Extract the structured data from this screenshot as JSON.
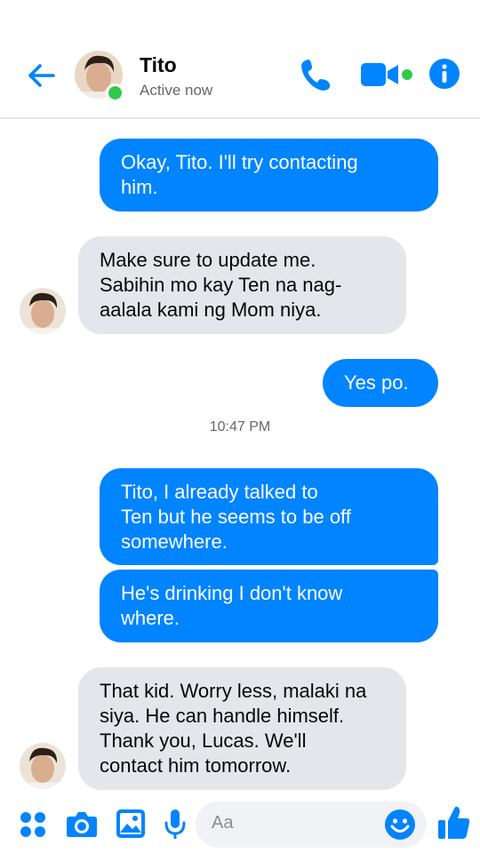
{
  "header": {
    "contact_name": "Tito",
    "status": "Active now"
  },
  "messages": [
    {
      "direction": "outgoing",
      "text": "Okay, Tito. I'll try contacting\nhim."
    },
    {
      "direction": "incoming",
      "text": "Make sure to update me.\nSabihin mo kay Ten na nag-\naalala kami ng Mom niya."
    },
    {
      "direction": "outgoing",
      "text": "Yes po."
    },
    {
      "direction": "outgoing",
      "text": "Tito, I already talked to\nTen but he seems to be off\nsomewhere."
    },
    {
      "direction": "outgoing",
      "text": "He's drinking I don't know\nwhere."
    },
    {
      "direction": "incoming",
      "text": "That kid. Worry less, malaki na\nsiya. He can handle himself.\nThank you, Lucas. We'll\ncontact him tomorrow."
    }
  ],
  "timestamp": "10:47 PM",
  "composer": {
    "placeholder": "Aa"
  },
  "icons": {
    "back": "back-arrow-icon",
    "call": "phone-icon",
    "video": "video-camera-icon",
    "info": "info-icon",
    "apps": "four-dots-icon",
    "camera": "camera-icon",
    "gallery": "image-icon",
    "voice": "microphone-icon",
    "emoji": "smiley-icon",
    "like": "thumbs-up-icon"
  },
  "colors": {
    "accent": "#0084ff",
    "online": "#31c94a",
    "incoming_bubble": "#e4e6eb"
  }
}
